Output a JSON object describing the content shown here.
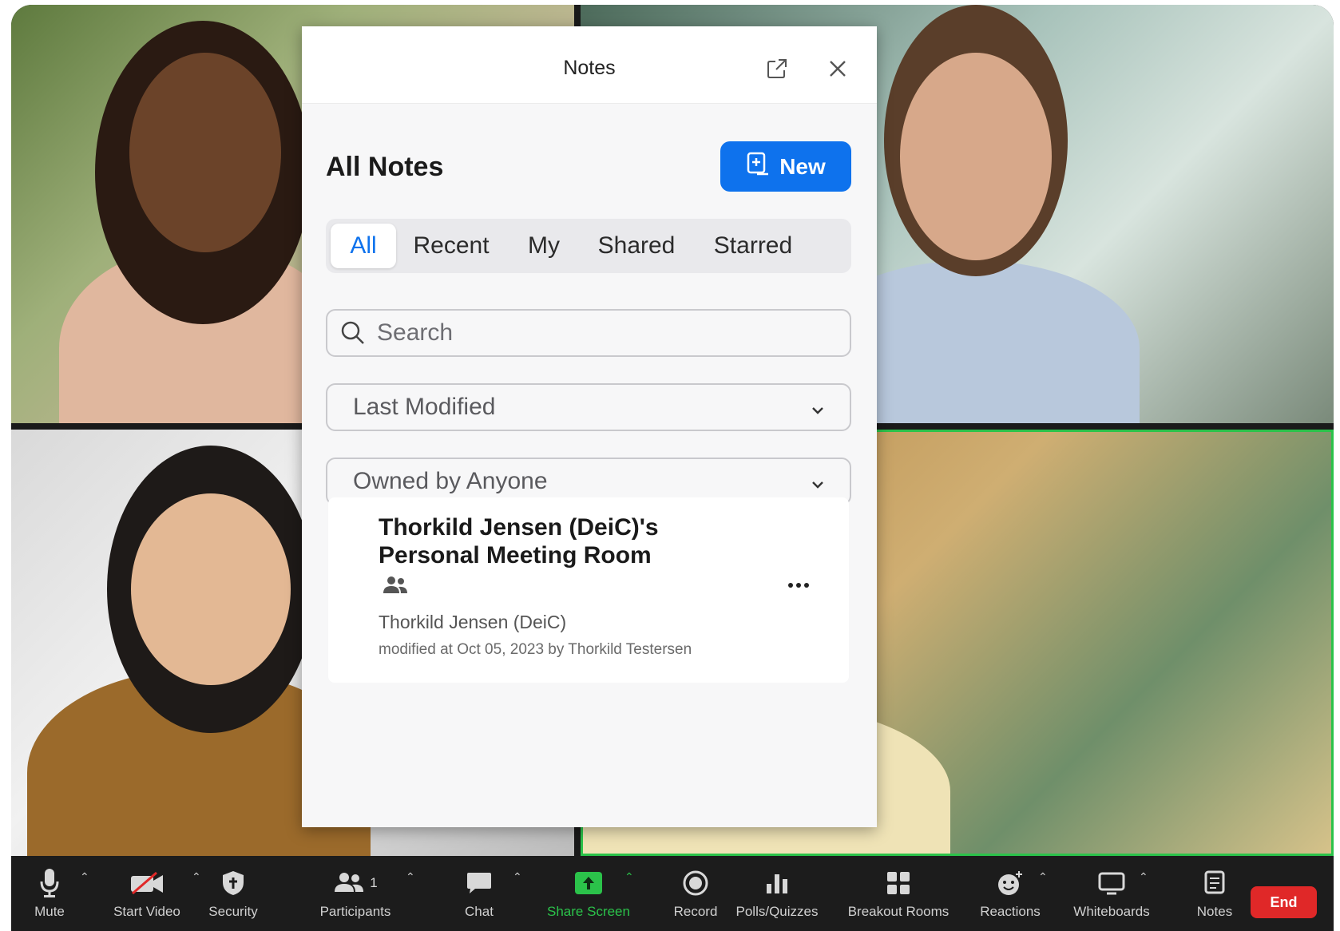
{
  "notes_panel": {
    "title": "Notes",
    "heading": "All Notes",
    "new_button": "New",
    "tabs": [
      "All",
      "Recent",
      "My",
      "Shared",
      "Starred"
    ],
    "active_tab": "All",
    "search": {
      "placeholder": "Search",
      "value": ""
    },
    "sort_select": "Last Modified",
    "owner_select": "Owned by Anyone",
    "notes": [
      {
        "title": "Thorkild Jensen (DeiC)'s Personal Meeting Room",
        "shared_icon": "people-icon",
        "owner": "Thorkild Jensen (DeiC)",
        "modified": "modified at Oct 05, 2023 by Thorkild Testersen"
      }
    ]
  },
  "toolbar": {
    "mute": "Mute",
    "start_video": "Start Video",
    "security": "Security",
    "participants": "Participants",
    "participants_count": "1",
    "chat": "Chat",
    "share_screen": "Share Screen",
    "record": "Record",
    "polls": "Polls/Quizzes",
    "breakout": "Breakout Rooms",
    "reactions": "Reactions",
    "whiteboards": "Whiteboards",
    "notes": "Notes",
    "end": "End"
  },
  "colors": {
    "accent_blue": "#0e72ed",
    "share_green": "#2bc24a",
    "end_red": "#e02828",
    "active_speaker_border": "#2bc24a"
  }
}
